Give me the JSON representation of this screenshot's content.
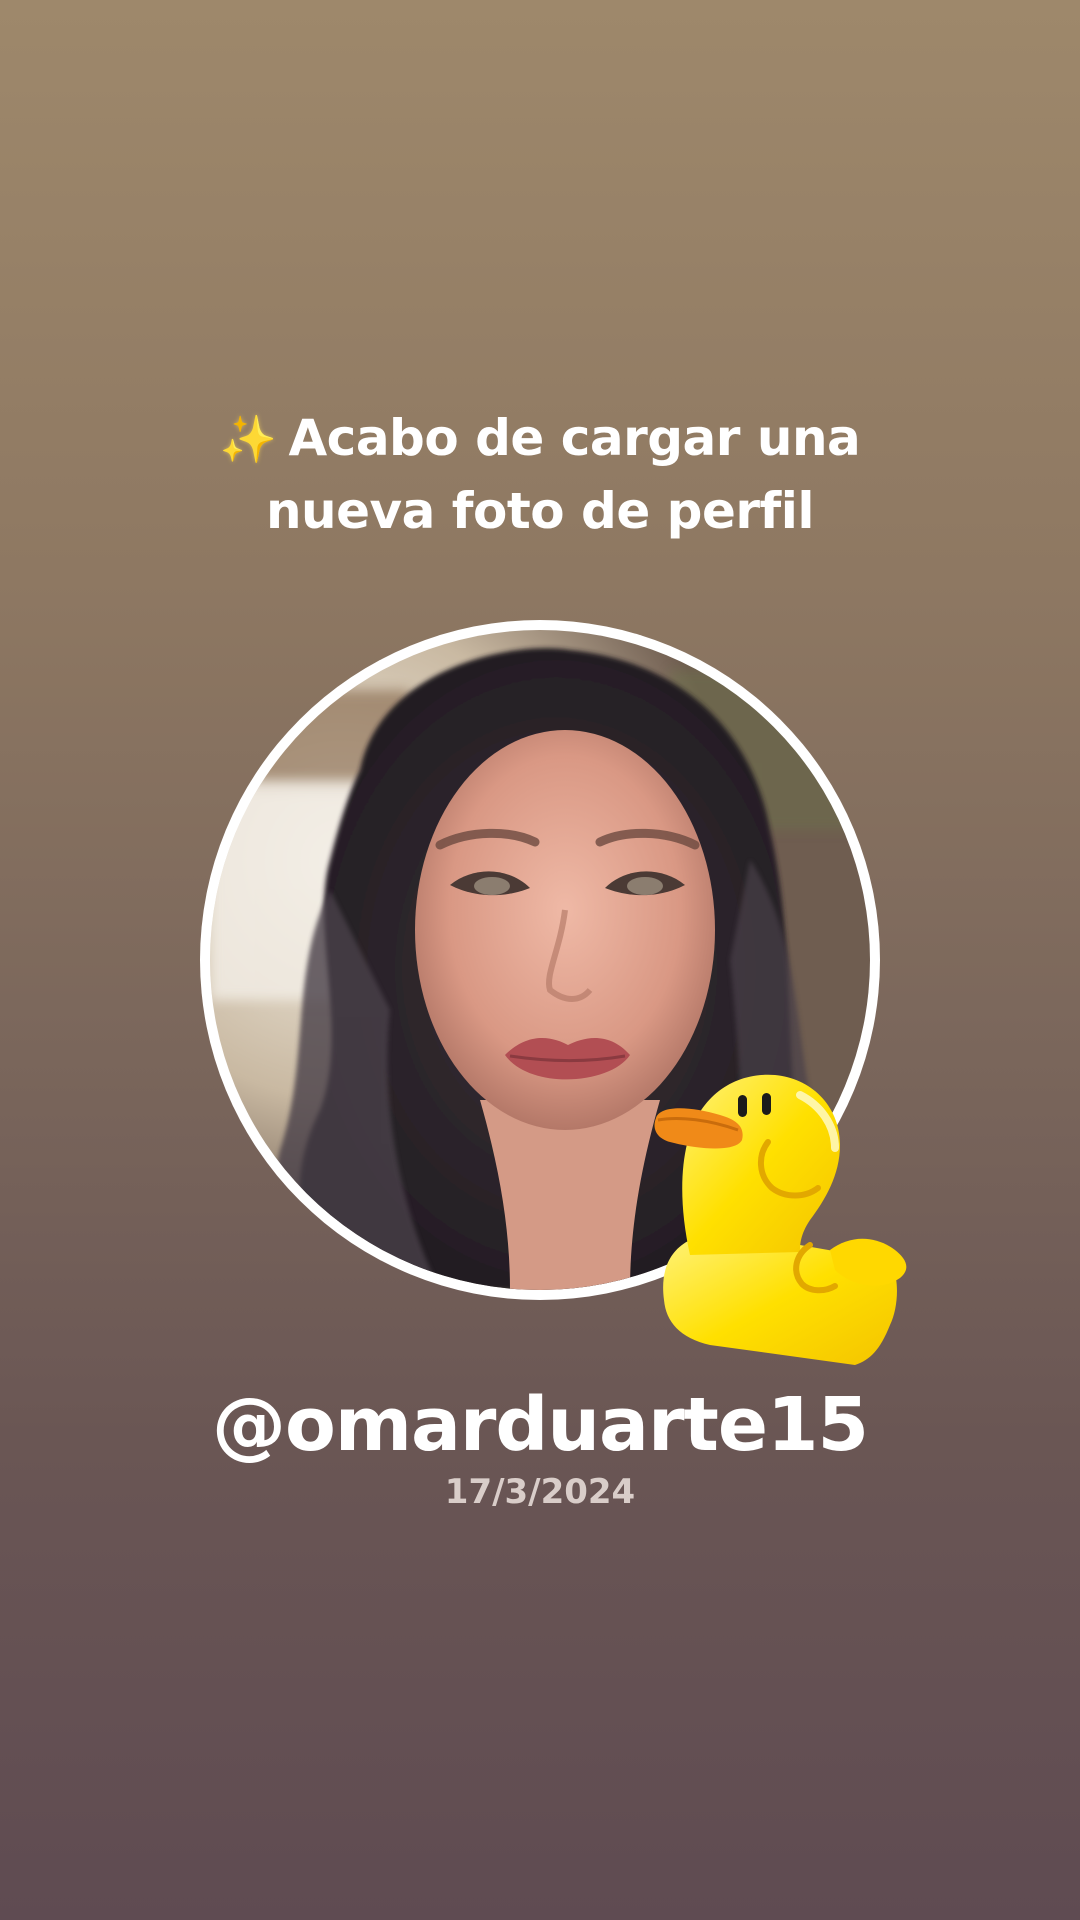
{
  "announcement": {
    "sparkle_icon": "✨",
    "line1": "Acabo de cargar una",
    "line2": "nueva foto de perfil"
  },
  "profile": {
    "username": "@omarduarte15",
    "date": "17/3/2024",
    "avatar_icon": "profile-photo",
    "sticker_icon": "rubber-duck-sticker"
  },
  "colors": {
    "background_top": "#9e886b",
    "background_bottom": "#5f4b52",
    "text": "#ffffff",
    "date_text": "#d9cdc9",
    "ring": "#ffffff",
    "duck_body": "#ffe000",
    "duck_beak": "#f08a18"
  }
}
